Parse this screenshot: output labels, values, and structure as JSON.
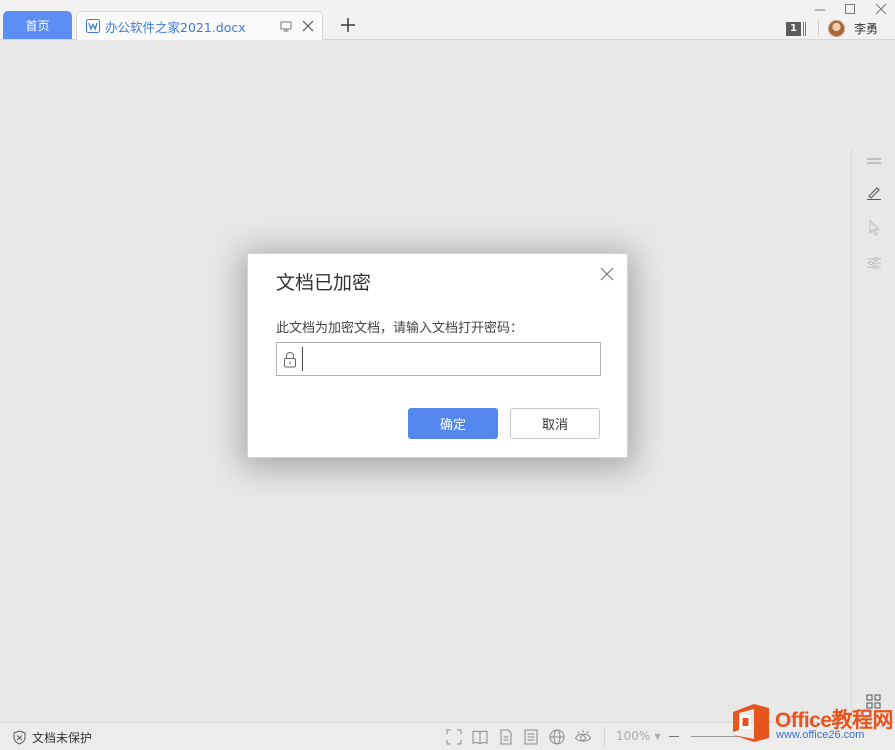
{
  "titlebar": {
    "home_tab": "首页",
    "doc_tab": "办公软件之家2021.docx",
    "tab_count": "1",
    "user_name": "李勇"
  },
  "dialog": {
    "title": "文档已加密",
    "message": "此文档为加密文档，请输入文档打开密码：",
    "password_value": "",
    "ok_label": "确定",
    "cancel_label": "取消"
  },
  "statusbar": {
    "protection": "文档未保护",
    "zoom": "100%"
  },
  "watermark": {
    "brand": "Office教程网",
    "url": "www.office26.com"
  },
  "colors": {
    "accent": "#5488ee",
    "home_tab": "#5d8ef4",
    "doc_title": "#3b7bd6",
    "watermark_orange": "#e8541e",
    "watermark_blue": "#3f6fc6"
  },
  "icons": [
    "doc-w-icon",
    "present-icon",
    "close-icon",
    "plus-icon",
    "minimize-icon",
    "maximize-icon",
    "window-close-icon",
    "menu-lines-icon",
    "pen-icon",
    "pointer-icon",
    "sliders-icon",
    "lock-icon",
    "shield-icon",
    "fullscreen-icon",
    "book-icon",
    "page-icon",
    "outline-icon",
    "web-icon",
    "eye-icon",
    "apps-grid-icon",
    "office-logo-icon"
  ]
}
